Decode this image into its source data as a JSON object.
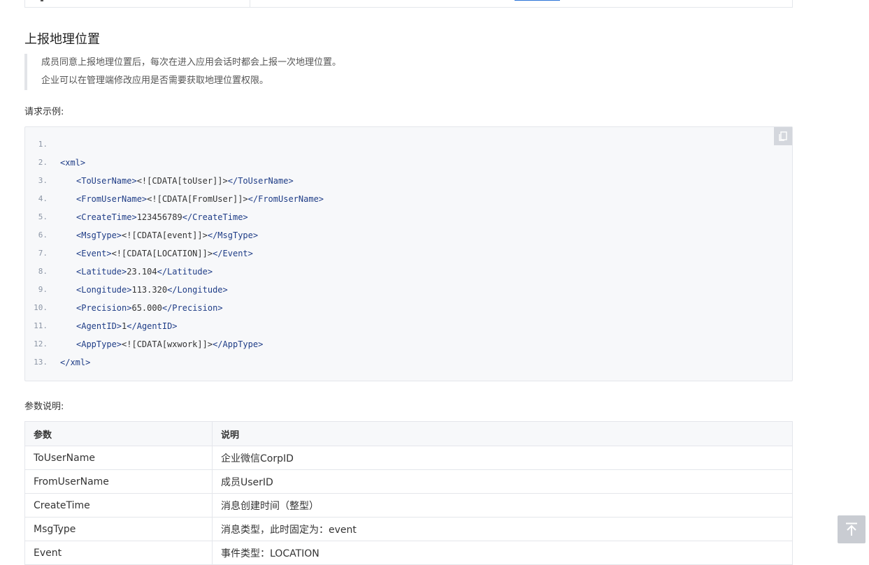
{
  "section": {
    "title": "上报地理位置",
    "notes": [
      "成员同意上报地理位置后，每次在进入应用会话时都会上报一次地理位置。",
      "企业可以在管理端修改应用是否需要获取地理位置权限。"
    ]
  },
  "request_example_label": "请求示例:",
  "code": {
    "copy_icon": "copy-icon",
    "lines": [
      {
        "n": "1.",
        "open": "",
        "text": "",
        "close": ""
      },
      {
        "n": "2.",
        "open": "<xml>",
        "text": "",
        "close": ""
      },
      {
        "n": "3.",
        "open": "<ToUserName>",
        "text": "<![CDATA[toUser]]>",
        "close": "</ToUserName>"
      },
      {
        "n": "4.",
        "open": "<FromUserName>",
        "text": "<![CDATA[FromUser]]>",
        "close": "</FromUserName>"
      },
      {
        "n": "5.",
        "open": "<CreateTime>",
        "text": "123456789",
        "close": "</CreateTime>"
      },
      {
        "n": "6.",
        "open": "<MsgType>",
        "text": "<![CDATA[event]]>",
        "close": "</MsgType>"
      },
      {
        "n": "7.",
        "open": "<Event>",
        "text": "<![CDATA[LOCATION]]>",
        "close": "</Event>"
      },
      {
        "n": "8.",
        "open": "<Latitude>",
        "text": "23.104",
        "close": "</Latitude>"
      },
      {
        "n": "9.",
        "open": "<Longitude>",
        "text": "113.320",
        "close": "</Longitude>"
      },
      {
        "n": "10.",
        "open": "<Precision>",
        "text": "65.000",
        "close": "</Precision>"
      },
      {
        "n": "11.",
        "open": "<AgentID>",
        "text": "1",
        "close": "</AgentID>"
      },
      {
        "n": "12.",
        "open": "<AppType>",
        "text": "<![CDATA[wxwork]]>",
        "close": "</AppType>"
      },
      {
        "n": "13.",
        "open": "",
        "text": "",
        "close": "</xml>"
      }
    ]
  },
  "params_label": "参数说明:",
  "params_table": {
    "headers": [
      "参数",
      "说明"
    ],
    "rows": [
      [
        "ToUserName",
        "企业微信CorpID"
      ],
      [
        "FromUserName",
        "成员UserID"
      ],
      [
        "CreateTime",
        "消息创建时间（整型）"
      ],
      [
        "MsgType",
        "消息类型，此时固定为：event"
      ],
      [
        "Event",
        "事件类型：LOCATION"
      ]
    ]
  },
  "back_to_top_icon": "arrow-up-to-top-icon"
}
